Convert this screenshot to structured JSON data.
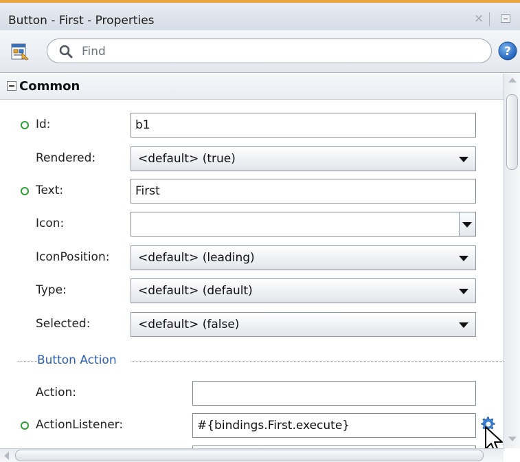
{
  "window": {
    "title": "Button - First - Properties",
    "close_glyph": "×"
  },
  "toolbar": {
    "icon": "binding-page-icon",
    "search_placeholder": "Find",
    "search_value": "",
    "help_icon": "help-icon"
  },
  "section": {
    "title": "Common",
    "expanded": true
  },
  "properties": {
    "id": {
      "label": "Id:",
      "value": "b1",
      "required": true
    },
    "rendered": {
      "label": "Rendered:",
      "value": "<default> (true)"
    },
    "text": {
      "label": "Text:",
      "value": "First",
      "required": true
    },
    "icon": {
      "label": "Icon:",
      "value": ""
    },
    "icon_position": {
      "label": "IconPosition:",
      "value": "<default> (leading)"
    },
    "type": {
      "label": "Type:",
      "value": "<default> (default)"
    },
    "selected": {
      "label": "Selected:",
      "value": "<default> (false)"
    }
  },
  "button_action": {
    "group_label": "Button Action",
    "action": {
      "label": "Action:",
      "value": ""
    },
    "action_listener": {
      "label": "ActionListener:",
      "value": "#{bindings.First.execute}",
      "required": true,
      "edit_icon": "gear-icon"
    }
  },
  "colors": {
    "title_accent": "#e8a33c",
    "required_dot": "#2f9e36",
    "group_label": "#2b5fae"
  }
}
